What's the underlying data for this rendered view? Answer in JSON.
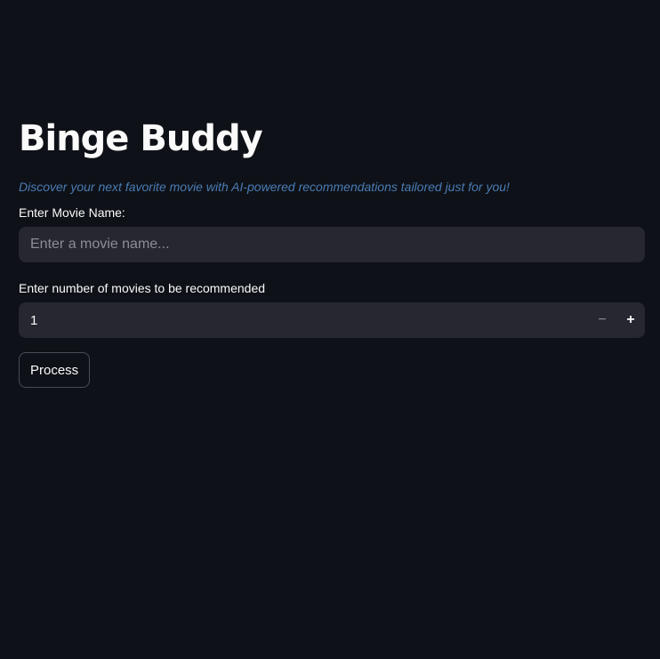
{
  "header": {
    "title": "Binge Buddy",
    "tagline": "Discover your next favorite movie with AI-powered recommendations tailored just for you!"
  },
  "movie_input": {
    "label": "Enter Movie Name:",
    "value": "",
    "placeholder": "Enter a movie name..."
  },
  "count_input": {
    "label": "Enter number of movies to be recommended",
    "value": "1",
    "decrement_symbol": "−",
    "increment_symbol": "+"
  },
  "actions": {
    "process_label": "Process"
  },
  "colors": {
    "background": "#0e1117",
    "input_background": "#262730",
    "tagline": "#4a7cb5",
    "text": "#fafafa"
  }
}
